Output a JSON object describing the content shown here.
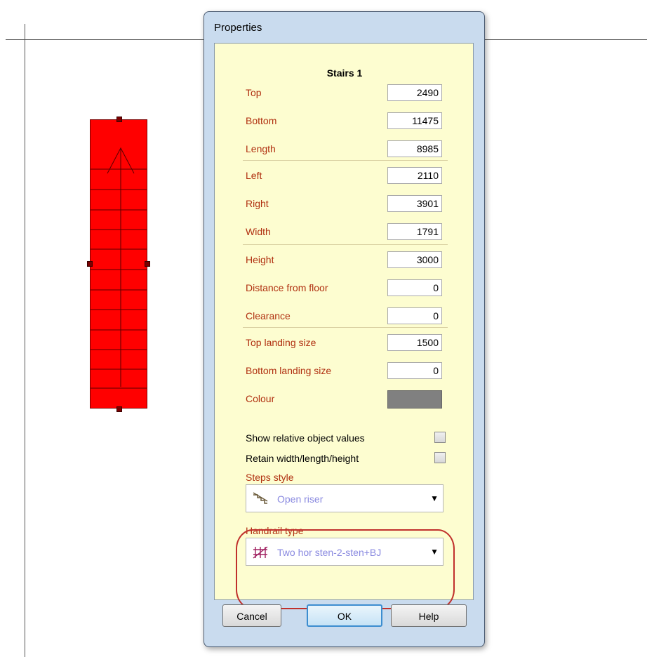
{
  "dialog": {
    "title": "Properties",
    "panel_title": "Stairs 1",
    "fields": [
      {
        "label": "Top",
        "value": "2490"
      },
      {
        "label": "Bottom",
        "value": "11475"
      },
      {
        "label": "Length",
        "value": "8985"
      },
      {
        "label": "Left",
        "value": "2110"
      },
      {
        "label": "Right",
        "value": "3901"
      },
      {
        "label": "Width",
        "value": "1791"
      },
      {
        "label": "Height",
        "value": "3000"
      },
      {
        "label": "Distance from floor",
        "value": "0"
      },
      {
        "label": "Clearance",
        "value": "0"
      },
      {
        "label": "Top landing size",
        "value": "1500"
      },
      {
        "label": "Bottom landing size",
        "value": "0"
      }
    ],
    "colour": {
      "label": "Colour",
      "value": "#808080"
    },
    "checkboxes": [
      {
        "label": "Show relative object values",
        "checked": false
      },
      {
        "label": "Retain width/length/height",
        "checked": false
      }
    ],
    "steps_style": {
      "label": "Steps style",
      "value": "Open riser",
      "icon": "stairs-icon"
    },
    "handrail_type": {
      "label": "Handrail type",
      "value": "Two hor sten-2-sten+BJ",
      "icon": "handrail-icon"
    },
    "buttons": {
      "cancel": "Cancel",
      "ok": "OK",
      "help": "Help"
    }
  },
  "canvas": {
    "stairs_color": "#ff0000",
    "highlight_color": "#c0302c"
  }
}
